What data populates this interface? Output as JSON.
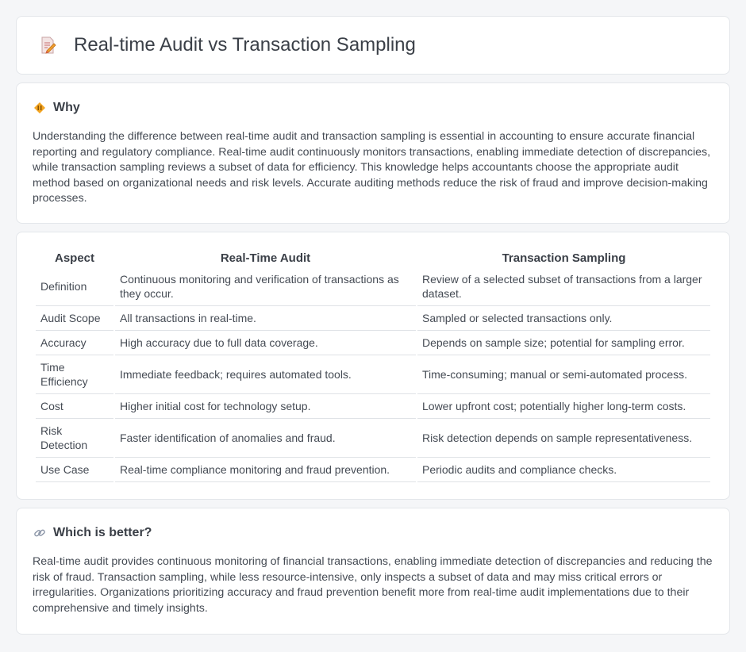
{
  "header": {
    "title": "Real-time Audit vs Transaction Sampling",
    "icon": "document-pencil-icon"
  },
  "why": {
    "title": "Why",
    "icon": "diamond-warning-icon",
    "text": "Understanding the difference between real-time audit and transaction sampling is essential in accounting to ensure accurate financial reporting and regulatory compliance. Real-time audit continuously monitors transactions, enabling immediate detection of discrepancies, while transaction sampling reviews a subset of data for efficiency. This knowledge helps accountants choose the appropriate audit method based on organizational needs and risk levels. Accurate auditing methods reduce the risk of fraud and improve decision-making processes."
  },
  "table": {
    "headers": [
      "Aspect",
      "Real-Time Audit",
      "Transaction Sampling"
    ],
    "rows": [
      [
        "Definition",
        "Continuous monitoring and verification of transactions as they occur.",
        "Review of a selected subset of transactions from a larger dataset."
      ],
      [
        "Audit Scope",
        "All transactions in real-time.",
        "Sampled or selected transactions only."
      ],
      [
        "Accuracy",
        "High accuracy due to full data coverage.",
        "Depends on sample size; potential for sampling error."
      ],
      [
        "Time Efficiency",
        "Immediate feedback; requires automated tools.",
        "Time-consuming; manual or semi-automated process."
      ],
      [
        "Cost",
        "Higher initial cost for technology setup.",
        "Lower upfront cost; potentially higher long-term costs."
      ],
      [
        "Risk Detection",
        "Faster identification of anomalies and fraud.",
        "Risk detection depends on sample representativeness."
      ],
      [
        "Use Case",
        "Real-time compliance monitoring and fraud prevention.",
        "Periodic audits and compliance checks."
      ]
    ]
  },
  "better": {
    "title": "Which is better?",
    "icon": "link-icon",
    "text": "Real-time audit provides continuous monitoring of financial transactions, enabling immediate detection of discrepancies and reducing the risk of fraud. Transaction sampling, while less resource-intensive, only inspects a subset of data and may miss critical errors or irregularities. Organizations prioritizing accuracy and fraud prevention benefit more from real-time audit implementations due to their comprehensive and timely insights."
  }
}
